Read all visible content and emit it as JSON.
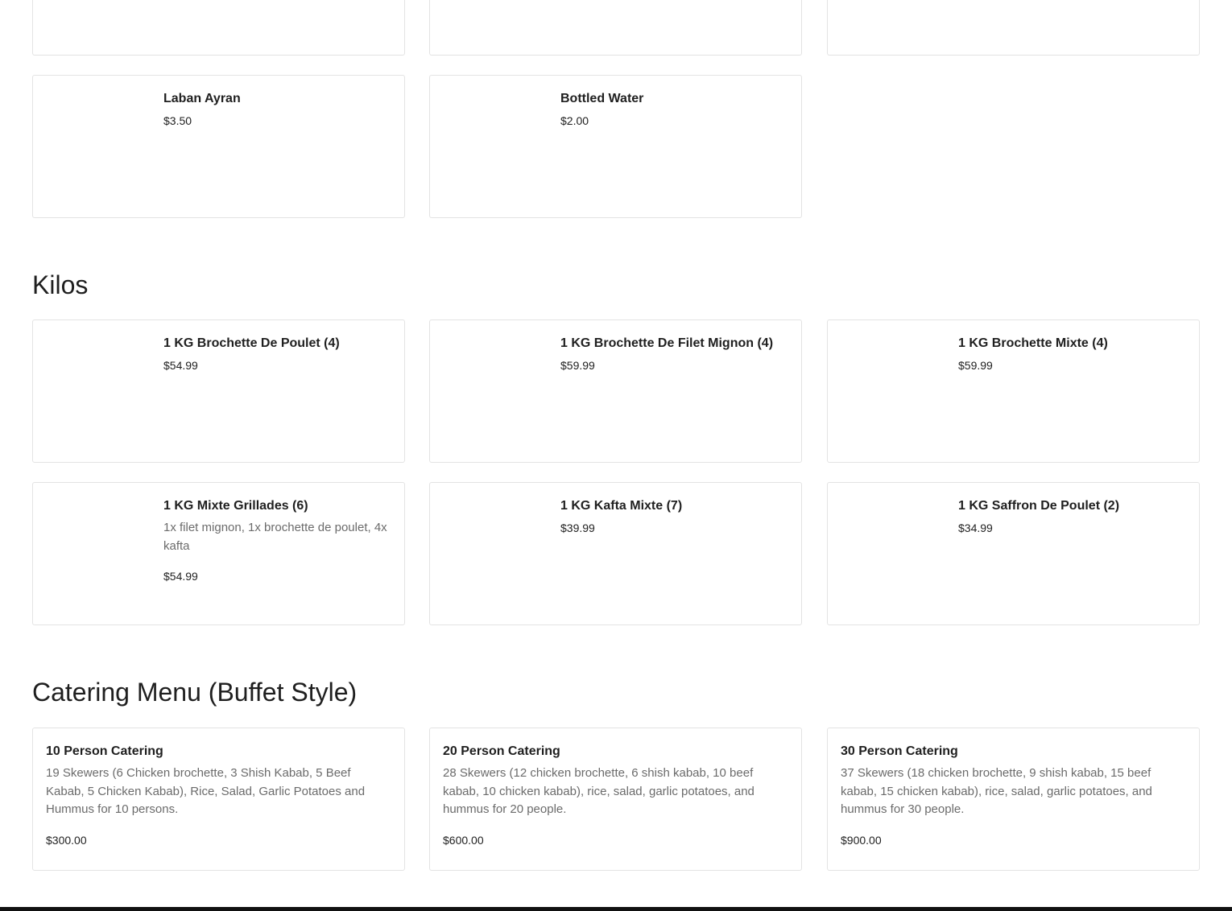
{
  "beverages": {
    "items": [
      {
        "name": "Laban Ayran",
        "price": "$3.50"
      },
      {
        "name": "Bottled Water",
        "price": "$2.00"
      }
    ]
  },
  "kilos": {
    "title": "Kilos",
    "items": [
      {
        "name": "1 KG Brochette De Poulet (4)",
        "price": "$54.99"
      },
      {
        "name": "1 KG Brochette De Filet Mignon (4)",
        "price": "$59.99"
      },
      {
        "name": "1 KG Brochette Mixte (4)",
        "price": "$59.99"
      },
      {
        "name": "1 KG Mixte Grillades (6)",
        "description": "1x filet mignon, 1x brochette de poulet, 4x kafta",
        "price": "$54.99"
      },
      {
        "name": "1 KG Kafta Mixte (7)",
        "price": "$39.99"
      },
      {
        "name": "1 KG Saffron De Poulet (2)",
        "price": "$34.99"
      }
    ]
  },
  "catering": {
    "title": "Catering Menu (Buffet Style)",
    "items": [
      {
        "name": "10 Person Catering",
        "description": "19 Skewers (6 Chicken brochette, 3 Shish Kabab, 5 Beef Kabab, 5 Chicken Kabab), Rice, Salad, Garlic Potatoes and Hummus for 10 persons.",
        "price": "$300.00"
      },
      {
        "name": "20 Person Catering",
        "description": "28 Skewers (12 chicken brochette, 6 shish kabab, 10 beef kabab, 10 chicken kabab), rice, salad, garlic potatoes, and hummus for 20 people.",
        "price": "$600.00"
      },
      {
        "name": "30 Person Catering",
        "description": "37 Skewers (18 chicken brochette, 9 shish kabab, 15 beef kabab, 15 chicken kabab), rice, salad, garlic potatoes, and hummus for 30 people.",
        "price": "$900.00"
      }
    ]
  }
}
